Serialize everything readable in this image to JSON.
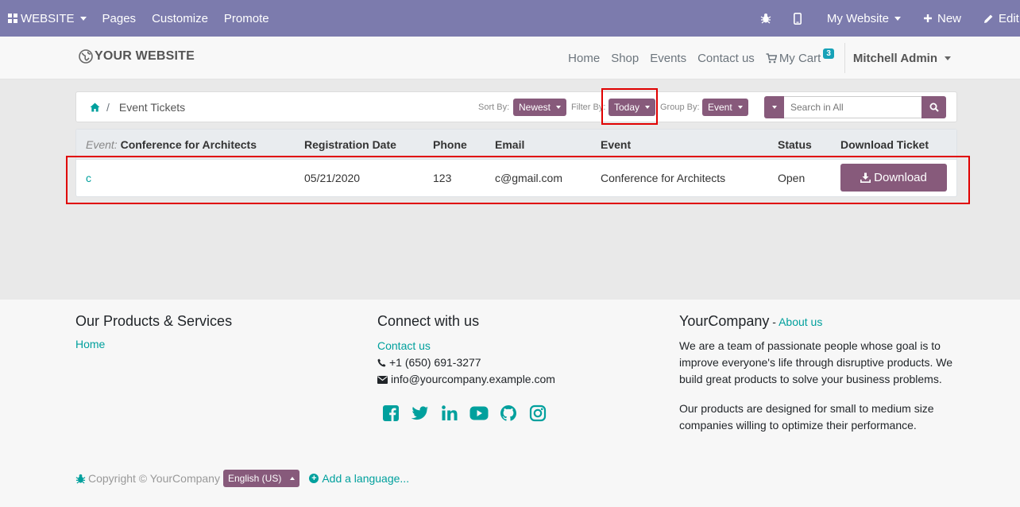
{
  "topbar": {
    "apps_label": "WEBSITE",
    "pages_label": "Pages",
    "customize_label": "Customize",
    "promote_label": "Promote",
    "website_label": "My Website",
    "new_label": "New",
    "edit_label": "Edit"
  },
  "header": {
    "logo_text": "YOUR WEBSITE",
    "nav": [
      "Home",
      "Shop",
      "Events",
      "Contact us"
    ],
    "cart_label": "My Cart",
    "cart_count": "3",
    "user_name": "Mitchell Admin"
  },
  "toolbar": {
    "breadcrumb_title": "Event Tickets",
    "sort_label": "Sort By:",
    "sort_value": "Newest",
    "filter_label": "Filter By:",
    "filter_value": "Today",
    "group_label": "Group By:",
    "group_value": "Event",
    "search_placeholder": "Search in All"
  },
  "table": {
    "group_prefix": "Event:",
    "group_name": "Conference for Architects",
    "headers": [
      "Registration Date",
      "Phone",
      "Email",
      "Event",
      "Status",
      "Download Ticket"
    ],
    "rows": [
      {
        "name": "c",
        "date": "05/21/2020",
        "phone": "123",
        "email": "c@gmail.com",
        "event": "Conference for Architects",
        "status": "Open",
        "action": "Download"
      }
    ]
  },
  "footer": {
    "col1_title": "Our Products & Services",
    "col1_link": "Home",
    "col2_title": "Connect with us",
    "col2_link": "Contact us",
    "phone": "+1 (650) 691-3277",
    "email": "info@yourcompany.example.com",
    "col3_title": "YourCompany",
    "col3_sep": " - ",
    "col3_link": "About us",
    "about_p1": "We are a team of passionate people whose goal is to improve everyone's life through disruptive products. We build great products to solve your business problems.",
    "about_p2": "Our products are designed for small to medium size companies willing to optimize their performance.",
    "copyright": "Copyright © YourCompany",
    "language": "English (US)",
    "add_language": "Add a language..."
  },
  "colors": {
    "topbar": "#7c7bad",
    "primary": "#875a7b",
    "link": "#00a09d",
    "highlight": "#e00000"
  }
}
